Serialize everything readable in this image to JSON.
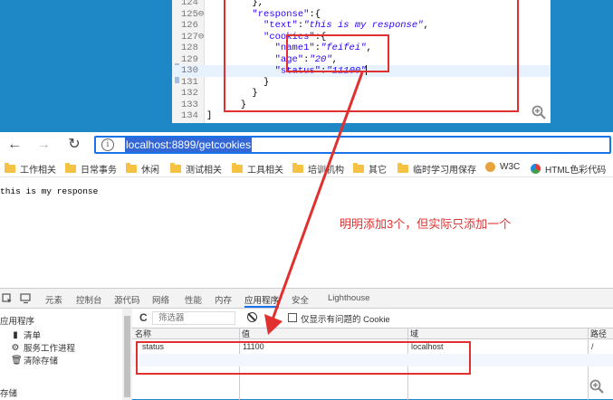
{
  "editor": {
    "lines": [
      {
        "num": "124",
        "tokens": [
          {
            "t": "p",
            "v": "        },"
          }
        ]
      },
      {
        "num": "125⊖",
        "tokens": [
          {
            "t": "p",
            "v": "        "
          },
          {
            "t": "key",
            "v": "\"response\""
          },
          {
            "t": "p",
            "v": ":{"
          }
        ]
      },
      {
        "num": "126",
        "tokens": [
          {
            "t": "p",
            "v": "          "
          },
          {
            "t": "key",
            "v": "\"text\""
          },
          {
            "t": "p",
            "v": ":"
          },
          {
            "t": "str",
            "v": "\"this is my response\""
          },
          {
            "t": "p",
            "v": ","
          }
        ]
      },
      {
        "num": "127⊖",
        "tokens": [
          {
            "t": "p",
            "v": "          "
          },
          {
            "t": "key",
            "v": "\"cookies\""
          },
          {
            "t": "p",
            "v": ":{"
          }
        ]
      },
      {
        "num": "128",
        "tokens": [
          {
            "t": "p",
            "v": "            "
          },
          {
            "t": "key",
            "v": "\"name1\""
          },
          {
            "t": "p",
            "v": ":"
          },
          {
            "t": "str",
            "v": "\"feifei\""
          },
          {
            "t": "p",
            "v": ","
          }
        ]
      },
      {
        "num": "129",
        "tokens": [
          {
            "t": "p",
            "v": "            "
          },
          {
            "t": "key",
            "v": "\"age\""
          },
          {
            "t": "p",
            "v": ":"
          },
          {
            "t": "str",
            "v": "\"20\""
          },
          {
            "t": "p",
            "v": ","
          }
        ]
      },
      {
        "num": "130",
        "tokens": [
          {
            "t": "p",
            "v": "            "
          },
          {
            "t": "key",
            "v": "\"status\""
          },
          {
            "t": "p",
            "v": ":"
          },
          {
            "t": "str",
            "v": "\"11100\""
          }
        ],
        "current": true
      },
      {
        "num": "131",
        "tokens": [
          {
            "t": "p",
            "v": "          }"
          }
        ]
      },
      {
        "num": "132",
        "tokens": [
          {
            "t": "p",
            "v": "        }"
          }
        ]
      },
      {
        "num": "133",
        "tokens": [
          {
            "t": "p",
            "v": "      }"
          }
        ]
      },
      {
        "num": "134",
        "tokens": [
          {
            "t": "p",
            "v": "]"
          }
        ]
      }
    ]
  },
  "browser": {
    "url": "localhost:8899/getcookies",
    "info_glyph": "i",
    "bookmarks": [
      "工作相关",
      "日常事务",
      "休闲",
      "测试相关",
      "工具相关",
      "培训机构",
      "其它",
      "临时学习用保存",
      "W3C",
      "HTML色彩代码"
    ],
    "page_text": "this is my response",
    "annotation": "明明添加3个，但实际只添加一个"
  },
  "devtools": {
    "tabs": [
      "元素",
      "控制台",
      "源代码",
      "网络",
      "性能",
      "内存",
      "应用程序",
      "安全",
      "Lighthouse"
    ],
    "active_tab": "应用程序",
    "sidebar": {
      "header": "应用程序",
      "items": [
        "清单",
        "服务工作进程",
        "清除存储"
      ],
      "section2": "存储"
    },
    "filter_placeholder": "筛选器",
    "checkbox_label": "仅显示有问题的 Cookie",
    "columns": [
      "名称",
      "值",
      "域",
      "路径"
    ],
    "rows": [
      {
        "name": "status",
        "value": "11100",
        "domain": "localhost",
        "path": "/"
      }
    ]
  },
  "colors": {
    "annotation": "#e03030",
    "url_highlight": "#3367d6",
    "desktop": "#1e87c6"
  }
}
